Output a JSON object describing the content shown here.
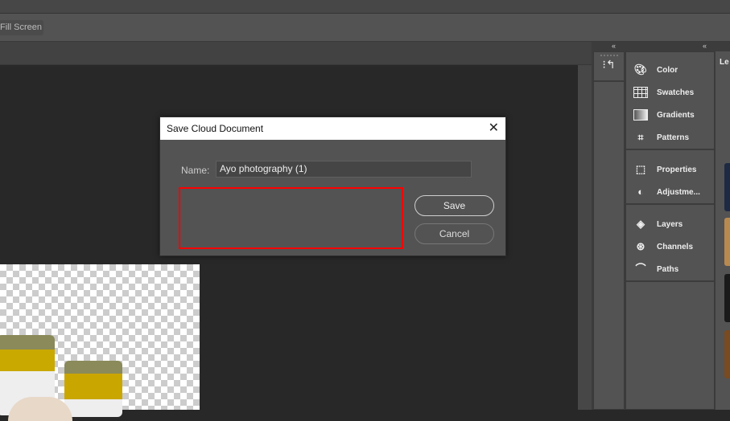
{
  "options_bar": {
    "fill_screen_label": "Fill Screen"
  },
  "panels": {
    "collapse_icon": "«",
    "groups": [
      [
        {
          "label": "Color",
          "icon": "palette-icon"
        },
        {
          "label": "Swatches",
          "icon": "grid-icon"
        },
        {
          "label": "Gradients",
          "icon": "gradient-icon"
        },
        {
          "label": "Patterns",
          "icon": "pattern-icon"
        }
      ],
      [
        {
          "label": "Properties",
          "icon": "properties-icon"
        },
        {
          "label": "Adjustme...",
          "icon": "adjustments-icon"
        }
      ],
      [
        {
          "label": "Layers",
          "icon": "layers-icon"
        },
        {
          "label": "Channels",
          "icon": "channels-icon"
        },
        {
          "label": "Paths",
          "icon": "paths-icon"
        }
      ]
    ],
    "learn_label": "Le"
  },
  "dialog": {
    "title": "Save Cloud Document",
    "name_label": "Name:",
    "name_value": "Ayo photography (1)",
    "save_label": "Save",
    "cancel_label": "Cancel",
    "highlight_color": "#ff0000"
  }
}
